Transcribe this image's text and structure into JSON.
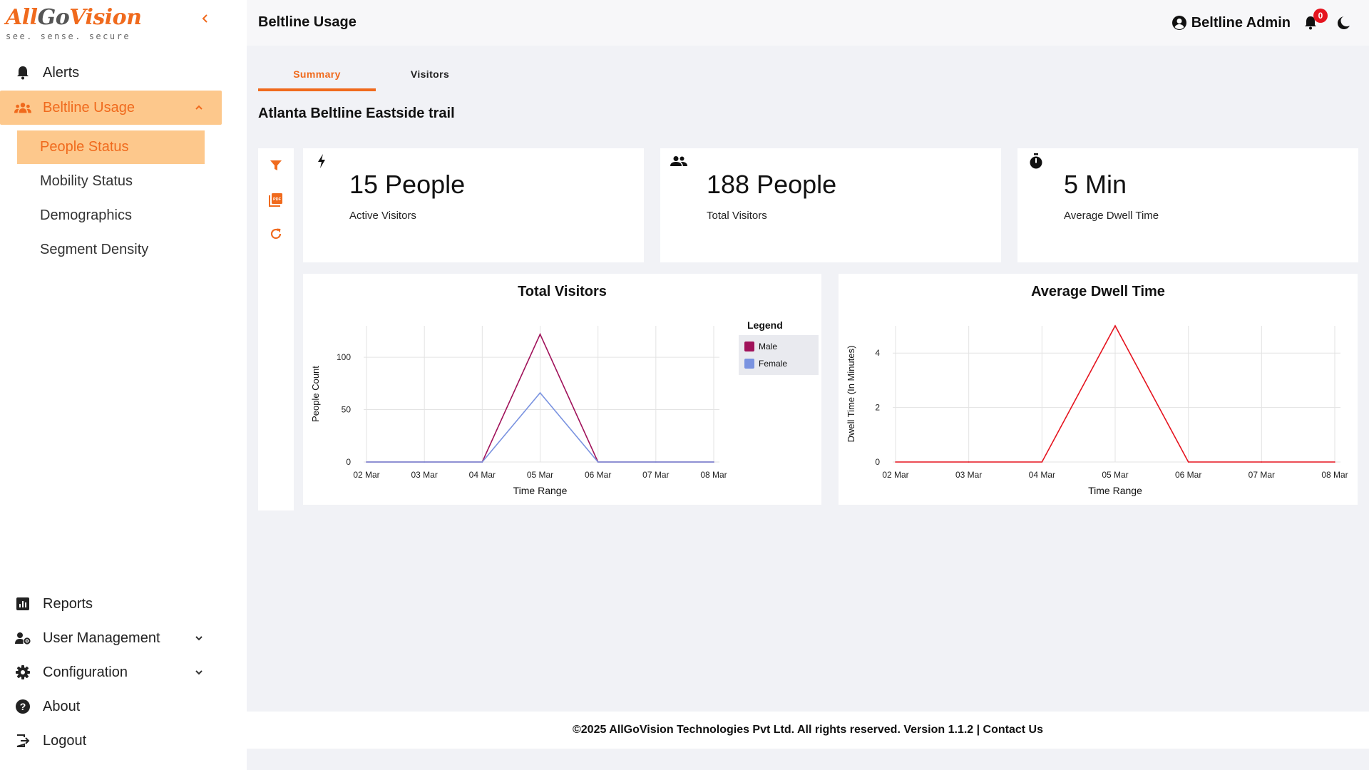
{
  "brand": {
    "logo_all": "All",
    "logo_go": "Go",
    "logo_vision": "Vision",
    "tagline": "see. sense. secure"
  },
  "sidebar": {
    "items": [
      {
        "label": "Alerts",
        "icon": "bell-icon"
      },
      {
        "label": "Beltline Usage",
        "icon": "groups-icon",
        "expanded": true
      },
      {
        "label": "Reports",
        "icon": "bar-chart-icon"
      },
      {
        "label": "User Management",
        "icon": "user-gear-icon"
      },
      {
        "label": "Configuration",
        "icon": "gear-icon"
      },
      {
        "label": "About",
        "icon": "help-icon"
      },
      {
        "label": "Logout",
        "icon": "logout-icon"
      }
    ],
    "sub_items": [
      {
        "label": "People Status",
        "active": true
      },
      {
        "label": "Mobility Status"
      },
      {
        "label": "Demographics"
      },
      {
        "label": "Segment Density"
      }
    ]
  },
  "header": {
    "title": "Beltline Usage",
    "user": "Beltline Admin",
    "notifications": "0"
  },
  "tabs": [
    {
      "label": "Summary",
      "active": true
    },
    {
      "label": "Visitors"
    }
  ],
  "location": "Atlanta Beltline Eastside trail",
  "kpis": [
    {
      "value": "15 People",
      "label": "Active Visitors",
      "icon": "bolt-icon"
    },
    {
      "value": "188 People",
      "label": "Total Visitors",
      "icon": "people-icon"
    },
    {
      "value": "5 Min",
      "label": "Average Dwell Time",
      "icon": "stopwatch-icon"
    }
  ],
  "colors": {
    "accent": "#f06a1d",
    "accent_light": "#fdc88c",
    "male": "#a0125a",
    "female": "#7a93e0",
    "dwell": "#e5141f",
    "badge": "#e5141f"
  },
  "chart_data": [
    {
      "type": "line",
      "title": "Total Visitors",
      "xlabel": "Time Range",
      "ylabel": "People Count",
      "categories": [
        "02 Mar",
        "03 Mar",
        "04 Mar",
        "05 Mar",
        "06 Mar",
        "07 Mar",
        "08 Mar"
      ],
      "yticks": [
        0,
        50,
        100
      ],
      "ylim": [
        0,
        130
      ],
      "legend_title": "Legend",
      "legend_position": "right",
      "series": [
        {
          "name": "Male",
          "values": [
            0,
            0,
            0,
            122,
            0,
            0,
            0
          ]
        },
        {
          "name": "Female",
          "values": [
            0,
            0,
            0,
            66,
            0,
            0,
            0
          ]
        }
      ],
      "grid": true
    },
    {
      "type": "line",
      "title": "Average Dwell Time",
      "xlabel": "Time Range",
      "ylabel": "Dwell Time (In Minutes)",
      "categories": [
        "02 Mar",
        "03 Mar",
        "04 Mar",
        "05 Mar",
        "06 Mar",
        "07 Mar",
        "08 Mar"
      ],
      "yticks": [
        0,
        2,
        4
      ],
      "ylim": [
        0,
        5
      ],
      "series": [
        {
          "values": [
            0,
            0,
            0,
            5,
            0,
            0,
            0
          ]
        }
      ],
      "grid": true
    }
  ],
  "footer": "©2025 AllGoVision Technologies Pvt Ltd. All rights reserved. Version 1.1.2 | Contact Us"
}
